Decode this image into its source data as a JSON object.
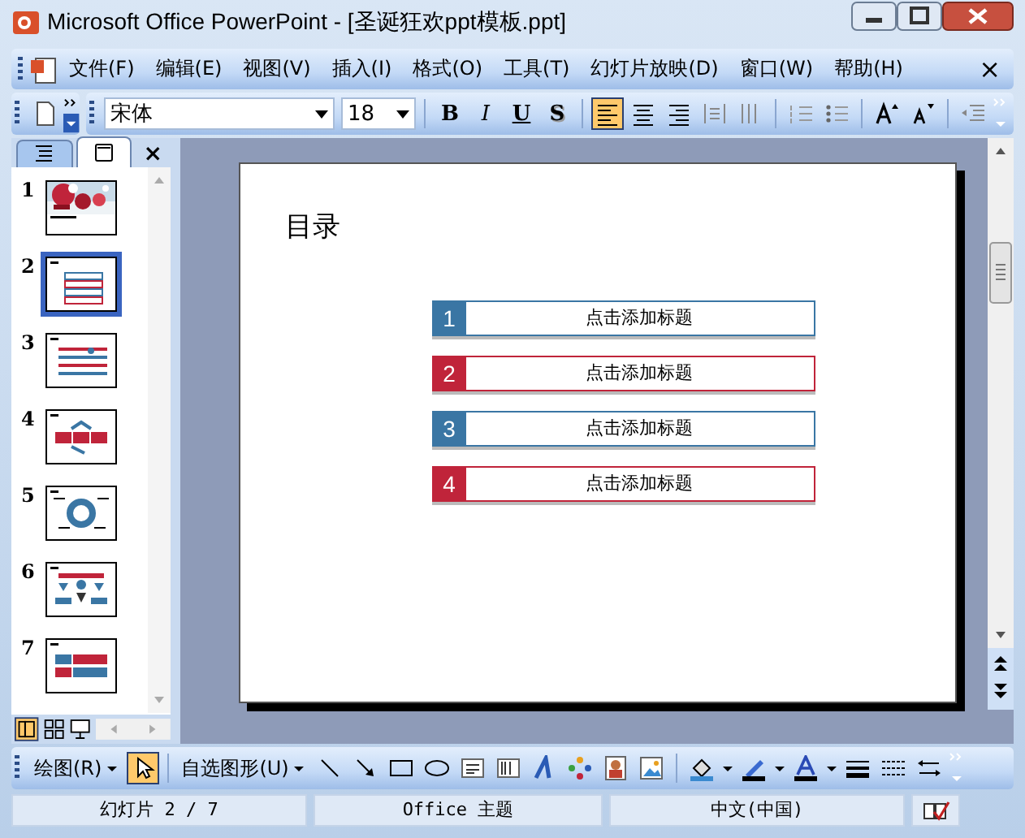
{
  "window": {
    "title": "Microsoft Office PowerPoint - [圣诞狂欢ppt模板.ppt]"
  },
  "menu": [
    {
      "label": "文件(F)"
    },
    {
      "label": "编辑(E)"
    },
    {
      "label": "视图(V)"
    },
    {
      "label": "插入(I)"
    },
    {
      "label": "格式(O)"
    },
    {
      "label": "工具(T)"
    },
    {
      "label": "幻灯片放映(D)"
    },
    {
      "label": "窗口(W)"
    },
    {
      "label": "帮助(H)"
    }
  ],
  "menu_close": "×",
  "toolbar": {
    "font": "宋体",
    "size": "18",
    "format_buttons": [
      {
        "label": "B",
        "kind": "bold"
      },
      {
        "label": "I",
        "kind": "italic"
      },
      {
        "label": "U",
        "kind": "underline"
      },
      {
        "label": "S",
        "kind": "shadow"
      }
    ],
    "align_buttons": [
      {
        "kind": "left",
        "selected": true
      },
      {
        "kind": "center",
        "selected": false
      },
      {
        "kind": "right",
        "selected": false
      }
    ]
  },
  "side_panel": {
    "tabs": [
      {
        "kind": "outline",
        "selected": false
      },
      {
        "kind": "slides",
        "selected": true
      }
    ],
    "close": "×",
    "thumbnails": [
      {
        "number": "1",
        "kind": "cover",
        "selected": false
      },
      {
        "number": "2",
        "kind": "list",
        "selected": true
      },
      {
        "number": "3",
        "kind": "timeline",
        "selected": false
      },
      {
        "number": "4",
        "kind": "process",
        "selected": false
      },
      {
        "number": "5",
        "kind": "cycle",
        "selected": false
      },
      {
        "number": "6",
        "kind": "tree",
        "selected": false
      },
      {
        "number": "7",
        "kind": "blocks",
        "selected": false
      }
    ]
  },
  "slide": {
    "title": "目录",
    "items": [
      {
        "number": "1",
        "text": "点击添加标题",
        "color": "#3a76a4"
      },
      {
        "number": "2",
        "text": "点击添加标题",
        "color": "#c0243a"
      },
      {
        "number": "3",
        "text": "点击添加标题",
        "color": "#3a76a4"
      },
      {
        "number": "4",
        "text": "点击添加标题",
        "color": "#c0243a"
      }
    ]
  },
  "drawing_toolbar": {
    "draw_menu": "绘图(R)",
    "autoshapes_menu": "自选图形(U)",
    "pointer_selected": true
  },
  "status_bar": [
    "幻灯片 2 / 7",
    "Office 主题",
    "中文(中国)"
  ]
}
